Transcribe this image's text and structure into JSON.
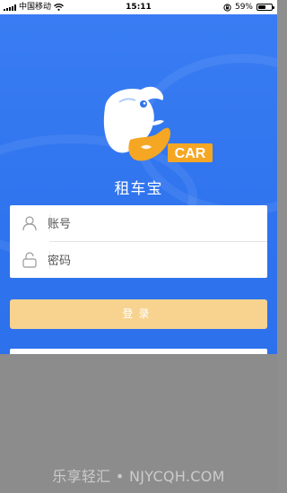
{
  "statusbar": {
    "carrier": "中国移动",
    "time": "15:11",
    "battery_percent": "59%",
    "battery_level": 0.59
  },
  "app": {
    "logo_badge": "CAR",
    "title": "租车宝"
  },
  "login_form": {
    "account_placeholder": "账号",
    "password_placeholder": "密码",
    "login_button": "登录"
  },
  "watermark": "乐享轻汇 • NJYCQH.COM",
  "colors": {
    "background_blue": "#3a7df3",
    "login_button": "#f7d38f",
    "logo_orange": "#f5a623"
  },
  "icons": {
    "account": "user-icon",
    "password": "lock-icon",
    "wifi": "wifi-icon",
    "lock_rotation": "rotation-lock-icon",
    "battery": "battery-icon",
    "signal": "signal-icon"
  }
}
